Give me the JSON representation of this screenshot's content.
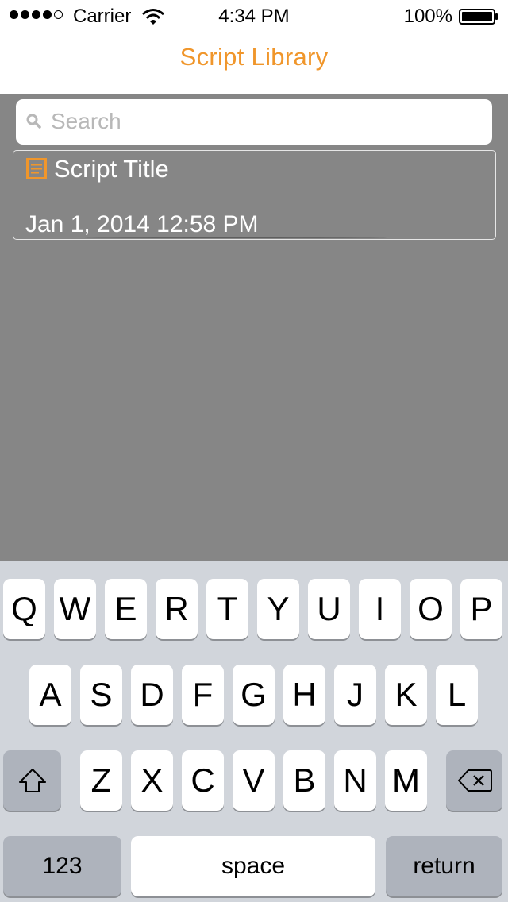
{
  "status_bar": {
    "carrier": "Carrier",
    "time": "4:34 PM",
    "battery": "100%"
  },
  "nav": {
    "title": "Script Library"
  },
  "search": {
    "placeholder": "Search",
    "value": ""
  },
  "scripts": [
    {
      "title": "Script Title",
      "date": "Jan 1, 2014 12:58 PM"
    }
  ],
  "keyboard": {
    "row1": [
      "Q",
      "W",
      "E",
      "R",
      "T",
      "Y",
      "U",
      "I",
      "O",
      "P"
    ],
    "row2": [
      "A",
      "S",
      "D",
      "F",
      "G",
      "H",
      "J",
      "K",
      "L"
    ],
    "row3": [
      "Z",
      "X",
      "C",
      "V",
      "B",
      "N",
      "M"
    ],
    "numbers_label": "123",
    "space_label": "space",
    "return_label": "return"
  },
  "colors": {
    "accent": "#f0962b",
    "background": "#868686",
    "keyboard": "#d1d5db"
  }
}
